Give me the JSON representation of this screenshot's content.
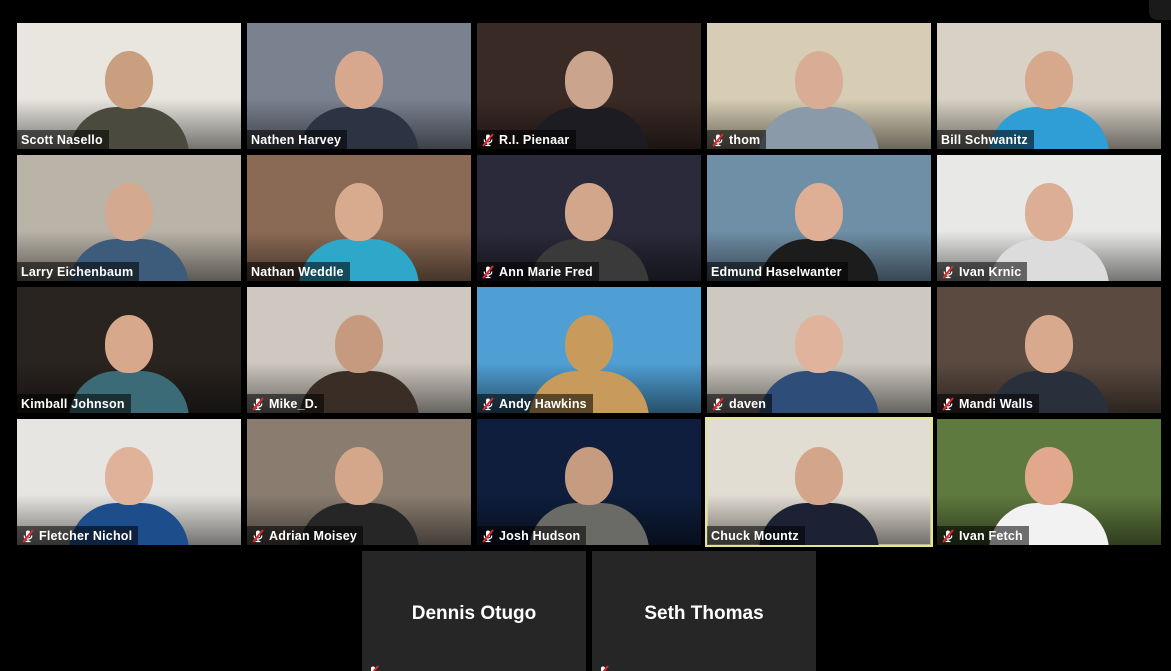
{
  "participants": [
    {
      "name": "Scott Nasello",
      "muted": false,
      "bg": "#e9e6df",
      "shirt": "#4a4a3f",
      "skin": "#c99f80"
    },
    {
      "name": "Nathen Harvey",
      "muted": false,
      "bg": "#7a8290",
      "shirt": "#2c3342",
      "skin": "#d8a88e"
    },
    {
      "name": "R.I. Pienaar",
      "muted": true,
      "bg": "#3a2a26",
      "shirt": "#1c1c22",
      "skin": "#caa48d"
    },
    {
      "name": "thom",
      "muted": true,
      "bg": "#d6cdb4",
      "shirt": "#8a9aa8",
      "skin": "#d9ad95"
    },
    {
      "name": "Bill Schwanitz",
      "muted": false,
      "bg": "#d8d2c6",
      "shirt": "#2f9ed6",
      "skin": "#d6a98d"
    },
    {
      "name": "Larry Eichenbaum",
      "muted": false,
      "bg": "#b9b3a8",
      "shirt": "#3d5b7a",
      "skin": "#d3a98f"
    },
    {
      "name": "Nathan Weddle",
      "muted": false,
      "bg": "#8b6a55",
      "shirt": "#2ea7c9",
      "skin": "#d8ab8e"
    },
    {
      "name": "Ann Marie Fred",
      "muted": true,
      "bg": "#2a2a3a",
      "shirt": "#3a3a3a",
      "skin": "#d2a68a"
    },
    {
      "name": "Edmund Haselwanter",
      "muted": false,
      "bg": "#6f8fa6",
      "shirt": "#1c1c1c",
      "skin": "#dfaf95"
    },
    {
      "name": "Ivan Krnic",
      "muted": true,
      "bg": "#e8e8e6",
      "shirt": "#dcdcdc",
      "skin": "#dcae95"
    },
    {
      "name": "Kimball Johnson",
      "muted": false,
      "bg": "#2a2420",
      "shirt": "#3b6b77",
      "skin": "#d7a88c"
    },
    {
      "name": "Mike_D.",
      "muted": true,
      "bg": "#cfc8c0",
      "shirt": "#3a2d26",
      "skin": "#c69a7e"
    },
    {
      "name": "Andy Hawkins",
      "muted": true,
      "bg": "#4f9fd4",
      "shirt": "#c89b5c",
      "skin": "#c89b5c"
    },
    {
      "name": "daven",
      "muted": true,
      "bg": "#cdc8c0",
      "shirt": "#2e4d78",
      "skin": "#e0b49c"
    },
    {
      "name": "Mandi Walls",
      "muted": true,
      "bg": "#5a4a40",
      "shirt": "#2a2f3c",
      "skin": "#d9a98e"
    },
    {
      "name": "Fletcher Nichol",
      "muted": true,
      "bg": "#e6e5e1",
      "shirt": "#1e4d8c",
      "skin": "#e0b29a"
    },
    {
      "name": "Adrian Moisey",
      "muted": true,
      "bg": "#8a7d70",
      "shirt": "#262626",
      "skin": "#d4a68a"
    },
    {
      "name": "Josh Hudson",
      "muted": true,
      "bg": "#0e1e3c",
      "shirt": "#6a6a66",
      "skin": "#c69c80"
    },
    {
      "name": "Chuck Mountz",
      "muted": false,
      "bg": "#e2ddd3",
      "shirt": "#1c2233",
      "skin": "#d3a68b",
      "active": true
    },
    {
      "name": "Ivan Fetch",
      "muted": true,
      "bg": "#5f7a3e",
      "shirt": "#f2f2f2",
      "skin": "#e2a88e"
    }
  ],
  "video_off": [
    {
      "name": "Dennis Otugo",
      "muted": true
    },
    {
      "name": "Seth Thomas",
      "muted": true
    }
  ],
  "colors": {
    "background": "#000000",
    "video_off_tile": "#262626",
    "active_speaker_border": "#e3e68a",
    "mute_icon_red": "#e0262f"
  }
}
